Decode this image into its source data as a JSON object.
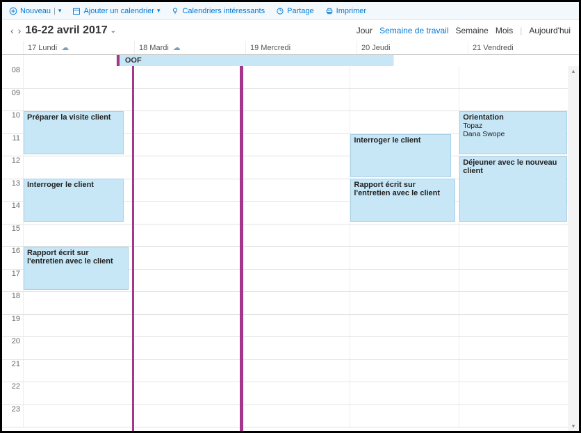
{
  "toolbar": {
    "new_label": "Nouveau",
    "add_calendar": "Ajouter un calendrier",
    "interesting_calendars": "Calendriers intéressants",
    "share": "Partage",
    "print": "Imprimer"
  },
  "nav": {
    "title": "16-22 avril 2017"
  },
  "views": {
    "day": "Jour",
    "work_week": "Semaine de travail",
    "week": "Semaine",
    "month": "Mois",
    "today": "Aujourd'hui"
  },
  "days": [
    {
      "label": "17 Lundi",
      "weather": true
    },
    {
      "label": "18 Mardi",
      "weather": true
    },
    {
      "label": "19 Mercredi",
      "weather": false
    },
    {
      "label": "20 Jeudi",
      "weather": false
    },
    {
      "label": "21 Vendredi",
      "weather": false
    }
  ],
  "allday": {
    "oof": "OOF"
  },
  "hours": [
    "08",
    "09",
    "10",
    "11",
    "12",
    "13",
    "14",
    "15",
    "16",
    "17",
    "18",
    "19",
    "20",
    "21",
    "22",
    "23"
  ],
  "events": {
    "mon_prep": "Préparer la visite client",
    "mon_int": "Interroger le client",
    "mon_rep": "Rapport écrit sur l'entretien avec le client",
    "thu_int": "Interroger le client",
    "thu_rep": "Rapport écrit sur l'entretien avec le client",
    "fri_orient_title": "Orientation",
    "fri_orient_loc": "Topaz",
    "fri_orient_person": "Dana Swope",
    "fri_lunch": "Déjeuner avec le nouveau client"
  }
}
